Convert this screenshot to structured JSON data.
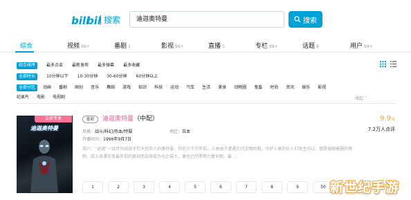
{
  "header": {
    "logo_text": "bilibili",
    "logo_sub": "搜索",
    "search_value": "迪迦奥特曼",
    "search_button": "搜索"
  },
  "tabs": [
    {
      "label": "综合",
      "count": "",
      "active": true
    },
    {
      "label": "视频",
      "count": "99+"
    },
    {
      "label": "番剧",
      "count": "1"
    },
    {
      "label": "影视",
      "count": "99+"
    },
    {
      "label": "直播",
      "count": "3"
    },
    {
      "label": "专栏",
      "count": "99+"
    },
    {
      "label": "话题",
      "count": "8"
    },
    {
      "label": "用户",
      "count": "99+"
    }
  ],
  "filters": {
    "sort": {
      "active": "综合排序",
      "options": [
        "最多点击",
        "最新发布",
        "最多弹幕",
        "最多收藏"
      ]
    },
    "duration": {
      "active": "全部时长",
      "options": [
        "10分钟以下",
        "10-30分钟",
        "30-60分钟",
        "60分钟以上"
      ]
    },
    "zone": {
      "active": "全部分区",
      "options": [
        "动画",
        "番剧",
        "国创",
        "音乐",
        "舞蹈",
        "游戏",
        "知识",
        "科技",
        "运动",
        "汽车",
        "生活",
        "美食",
        "动物圈",
        "鬼畜",
        "时尚",
        "资讯",
        "娱乐",
        "影视"
      ]
    },
    "zone_row2": [
      "纪录片",
      "电影",
      "电视剧"
    ],
    "collapse": "收起"
  },
  "result": {
    "poster_tag": "会员专享",
    "poster_title": "迪迦奥特曼",
    "type_badge": "番剧",
    "title_highlight": "迪迦奥特曼",
    "title_suffix": "（中配）",
    "style_label": "风格：",
    "style_value": "战斗/科幻/热血/特摄",
    "region_label": "地区：",
    "region_value": "日本",
    "date_label": "开播时间：",
    "date_value": "1996年9月7日",
    "desc": "简介：“迪迦”一现世为出现于巨大的巨人的奥特曼，约在三千万年前，人类由于遭遇古代文明时期，守护人类的巨人们发生内讧，那是由随着圈的两侧、成士身遇巨变最伴侣的复劫而选择成为光之城士，便也已的黑暗力量长眠。最 ...",
    "score": "9.9",
    "score_unit": "分",
    "ratings": "7.2万人点评",
    "episodes": [
      "1",
      "2",
      "3",
      "4",
      "5",
      "6",
      "7",
      "8",
      "9",
      "50"
    ]
  },
  "watermark": "新世纪手游",
  "colors": {
    "accent": "#00a1d6",
    "pink": "#fb7299",
    "score": "#f5a623"
  }
}
